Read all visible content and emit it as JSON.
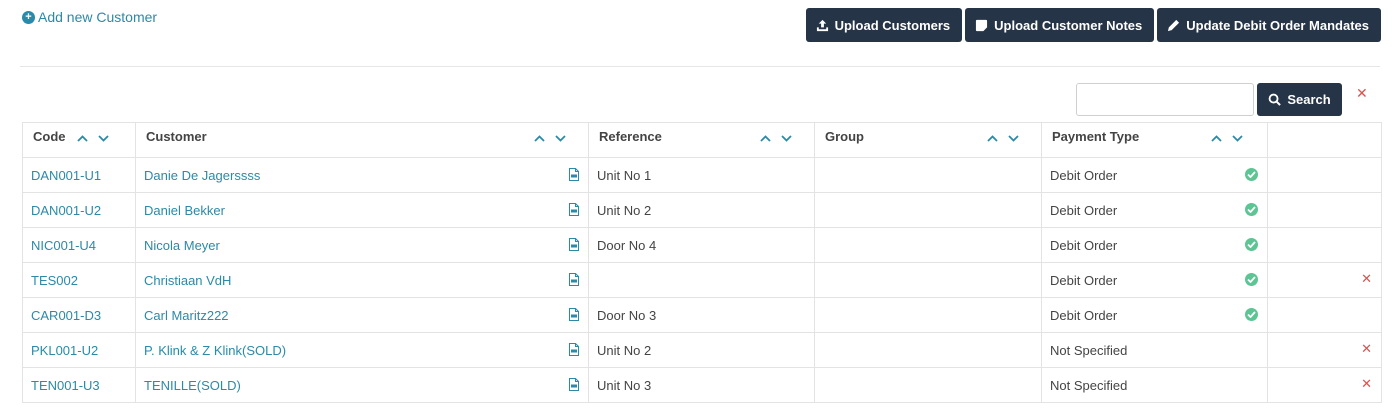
{
  "header": {
    "add_customer_label": "Add new Customer",
    "buttons": {
      "upload_customers": "Upload Customers",
      "upload_notes": "Upload Customer Notes",
      "update_mandates": "Update Debit Order Mandates"
    }
  },
  "search": {
    "value": "",
    "button_label": "Search",
    "clear_icon": "close-icon"
  },
  "table": {
    "columns": [
      "Code",
      "Customer",
      "Reference",
      "Group",
      "Payment Type",
      ""
    ],
    "rows": [
      {
        "code": "DAN001-U1",
        "customer": "Danie De Jagerssss",
        "reference": "Unit No 1",
        "group": "",
        "payment": "Debit Order",
        "status": "ok",
        "delete": false
      },
      {
        "code": "DAN001-U2",
        "customer": "Daniel Bekker",
        "reference": "Unit No 2",
        "group": "",
        "payment": "Debit Order",
        "status": "ok",
        "delete": false
      },
      {
        "code": "NIC001-U4",
        "customer": "Nicola Meyer",
        "reference": "Door No 4",
        "group": "",
        "payment": "Debit Order",
        "status": "ok",
        "delete": false
      },
      {
        "code": "TES002",
        "customer": "Christiaan VdH",
        "reference": "",
        "group": "",
        "payment": "Debit Order",
        "status": "ok",
        "delete": true
      },
      {
        "code": "CAR001-D3",
        "customer": "Carl Maritz222",
        "reference": "Door No 3",
        "group": "",
        "payment": "Debit Order",
        "status": "ok",
        "delete": false
      },
      {
        "code": "PKL001-U2",
        "customer": "P. Klink & Z Klink(SOLD)",
        "reference": "Unit No 2",
        "group": "",
        "payment": "Not Specified",
        "status": "",
        "delete": true
      },
      {
        "code": "TEN001-U3",
        "customer": "TENILLE(SOLD)",
        "reference": "Unit No 3",
        "group": "",
        "payment": "Not Specified",
        "status": "",
        "delete": true
      }
    ]
  },
  "colors": {
    "primary_dark": "#253447",
    "link": "#2a8aa8",
    "success": "#5cc593",
    "danger": "#d9534f"
  }
}
